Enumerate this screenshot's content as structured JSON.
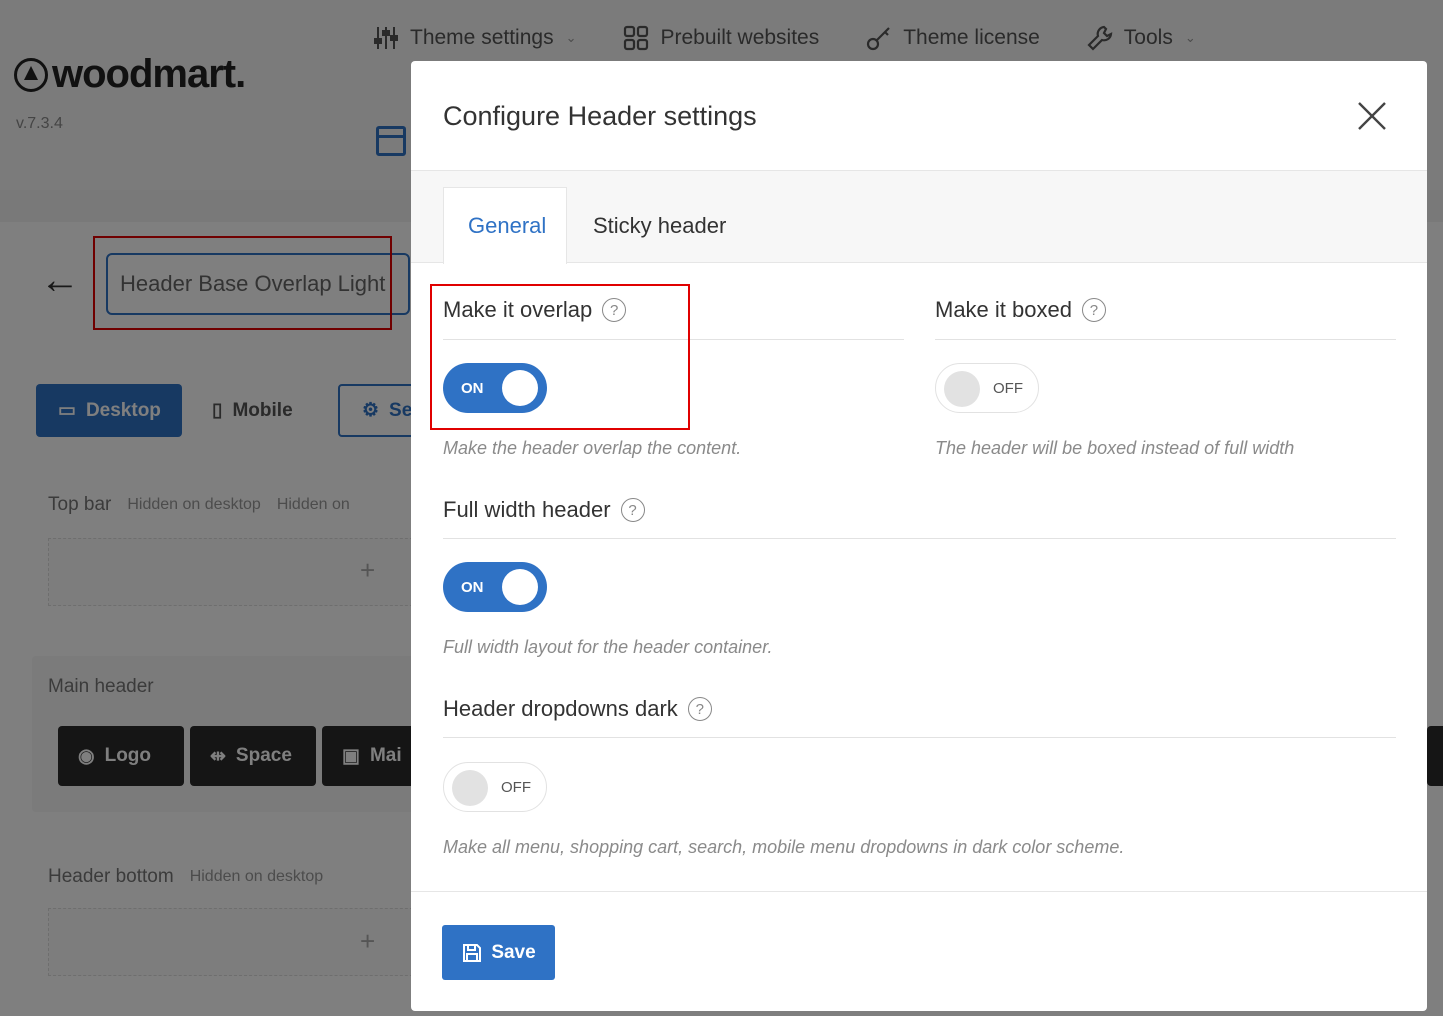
{
  "brand": {
    "name": "woodmart.",
    "version": "v.7.3.4"
  },
  "nav": {
    "items": [
      {
        "label": "Theme settings",
        "icon": "sliders-icon",
        "has_caret": true
      },
      {
        "label": "Prebuilt websites",
        "icon": "grid-icon",
        "has_caret": false
      },
      {
        "label": "Theme license",
        "icon": "key-icon",
        "has_caret": false
      },
      {
        "label": "Tools",
        "icon": "wrench-icon",
        "has_caret": true
      }
    ]
  },
  "editor": {
    "header_name": "Header Base Overlap Light",
    "devices": {
      "desktop": "Desktop",
      "mobile": "Mobile",
      "settings": "Se"
    },
    "rows": {
      "top_bar": "Top bar",
      "main_header": "Main header",
      "header_bottom": "Header bottom",
      "hidden_desktop": "Hidden on desktop",
      "hidden_mobile": "Hidden on"
    },
    "chips": {
      "logo": "Logo",
      "space": "Space",
      "main": "Mai"
    }
  },
  "modal": {
    "title": "Configure Header settings",
    "tabs": [
      {
        "label": "General",
        "active": true
      },
      {
        "label": "Sticky header",
        "active": false
      }
    ],
    "settings": {
      "overlap": {
        "title": "Make it overlap",
        "state": "ON",
        "description": "Make the header overlap the content."
      },
      "boxed": {
        "title": "Make it boxed",
        "state": "OFF",
        "description": "The header will be boxed instead of full width"
      },
      "full_width": {
        "title": "Full width header",
        "state": "ON",
        "description": "Full width layout for the header container."
      },
      "dropdowns_dark": {
        "title": "Header dropdowns dark",
        "state": "OFF",
        "description": "Make all menu, shopping cart, search, mobile menu dropdowns in dark color scheme."
      }
    },
    "help_glyph": "?",
    "save_label": "Save"
  },
  "colors": {
    "accent": "#2f72c5",
    "highlight": "#e00000",
    "overlay": "rgba(0,0,0,0.5)"
  }
}
